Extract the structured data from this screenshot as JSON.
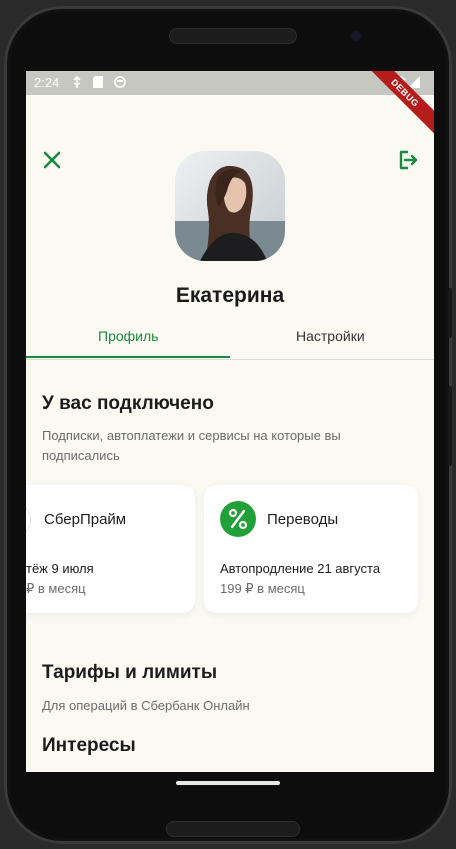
{
  "status_bar": {
    "time": "2:24",
    "debug_label": "DEBUG"
  },
  "profile": {
    "name": "Екатерина"
  },
  "tabs": [
    {
      "label": "Профиль",
      "active": true
    },
    {
      "label": "Настройки",
      "active": false
    }
  ],
  "connected": {
    "title": "У вас подключено",
    "subtitle_line1": "Подписки, автоплатежи и сервисы на которые вы",
    "subtitle_line2": "подписались",
    "cards": [
      {
        "name": "СберПрайм",
        "line1": "тёж 9 июля",
        "line2": "₽ в месяц"
      },
      {
        "name": "Переводы",
        "icon_symbol": "%",
        "line1": "Автопродление 21 августа",
        "line2": "199 ₽ в месяц"
      }
    ]
  },
  "tariffs": {
    "title": "Тарифы и лимиты",
    "subtitle": "Для операций в Сбербанк Онлайн"
  },
  "interests": {
    "title": "Интересы"
  },
  "colors": {
    "accent": "#1a8a3d",
    "icon_green": "#21a038",
    "background": "#fafaf3",
    "debug": "#b71c1c"
  }
}
